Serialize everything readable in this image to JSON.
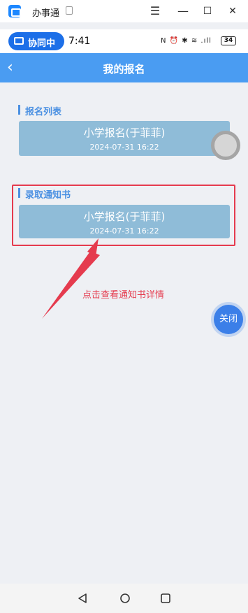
{
  "window": {
    "title": "办事通",
    "menu_glyph": "☰",
    "minimize_glyph": "—",
    "maximize_glyph": "☐",
    "close_glyph": "✕"
  },
  "status_bar": {
    "collab_label": "协同中",
    "time": "7:41",
    "icons_text": "N ⏰ ✱ ≋ .ıll",
    "battery": "34"
  },
  "nav": {
    "back_glyph": "‹",
    "title": "我的报名"
  },
  "sections": {
    "list": {
      "title": "报名列表",
      "card": {
        "name": "小学报名(于菲菲)",
        "date": "2024-07-31 16:22"
      }
    },
    "admission": {
      "title": "录取通知书",
      "card": {
        "name": "小学报名(于菲菲)",
        "date": "2024-07-31 16:22"
      }
    }
  },
  "annotation": {
    "text": "点击查看通知书详情",
    "color": "#e53b4e"
  },
  "floating": {
    "close_label": "关闭"
  },
  "colors": {
    "nav_bg": "#4a9cf2",
    "card_bg": "#8fbcd8",
    "section_title": "#4a90e2",
    "collab_bg": "#1c6fe8"
  }
}
